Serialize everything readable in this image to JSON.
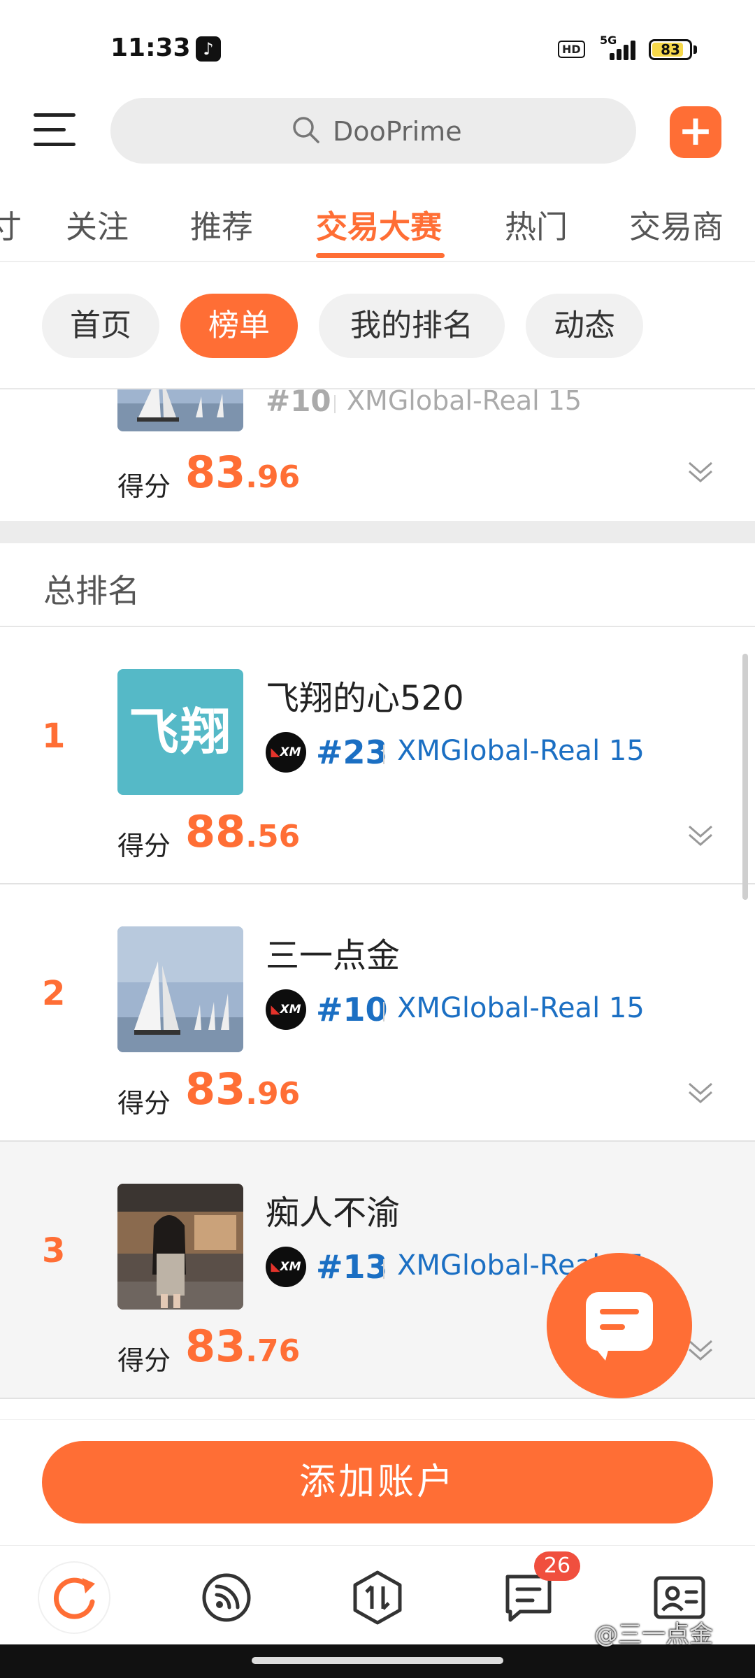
{
  "status_bar": {
    "time": "11:33",
    "hd": "HD",
    "network": "5G",
    "battery": "83"
  },
  "search": {
    "placeholder": "DooPrime"
  },
  "tabs": [
    {
      "label": "关注"
    },
    {
      "label": "推荐"
    },
    {
      "label": "交易大赛"
    },
    {
      "label": "热门"
    },
    {
      "label": "交易商"
    }
  ],
  "tab_cut_label": "寸",
  "subtabs": [
    {
      "label": "首页"
    },
    {
      "label": "榜单"
    },
    {
      "label": "我的排名"
    },
    {
      "label": "动态"
    }
  ],
  "partial_card": {
    "account": "#10",
    "server": "XMGlobal-Real 15",
    "score_label": "得分",
    "score_int": "83",
    "score_dec": ".96"
  },
  "section_title": "总排名",
  "rankings": [
    {
      "rank": "1",
      "name": "飞翔的心520",
      "avatar_text": "飞翔",
      "broker": "XM",
      "account": "#23",
      "server": "XMGlobal-Real 15",
      "score_label": "得分",
      "score_int": "88",
      "score_dec": ".56"
    },
    {
      "rank": "2",
      "name": "三一点金",
      "broker": "XM",
      "account": "#10",
      "server": "XMGlobal-Real 15",
      "score_label": "得分",
      "score_int": "83",
      "score_dec": ".96"
    },
    {
      "rank": "3",
      "name": "痴人不渝",
      "broker": "XM",
      "account": "#13",
      "server": "XMGlobal-Real 15",
      "score_label": "得分",
      "score_int": "83",
      "score_dec": ".76"
    }
  ],
  "add_account_label": "添加账户",
  "bottom_nav": {
    "messages_badge": "26"
  },
  "watermark": "@三一点金",
  "colors": {
    "accent": "#ff6e35",
    "link": "#1b6fc3",
    "badge": "#f04f3e"
  }
}
